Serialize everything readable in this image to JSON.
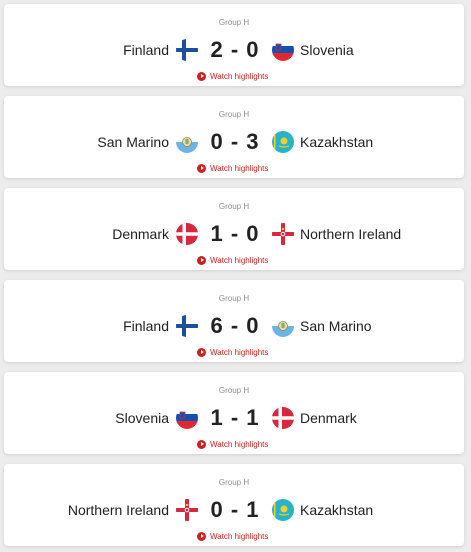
{
  "colors": {
    "background": "#ececec",
    "card": "#ffffff",
    "accent_red": "#d01e1e",
    "text": "#222222",
    "muted": "#8f8f8f"
  },
  "matches": [
    {
      "group": "Group H",
      "home": "Finland",
      "home_flag": "finland-flag",
      "score": "2 - 0",
      "away": "Slovenia",
      "away_flag": "slovenia-flag",
      "watch_label": "Watch highlights"
    },
    {
      "group": "Group H",
      "home": "San Marino",
      "home_flag": "san-marino-flag",
      "score": "0 - 3",
      "away": "Kazakhstan",
      "away_flag": "kazakhstan-flag",
      "watch_label": "Watch highlights"
    },
    {
      "group": "Group H",
      "home": "Denmark",
      "home_flag": "denmark-flag",
      "score": "1 - 0",
      "away": "Northern Ireland",
      "away_flag": "northern-ireland-flag",
      "watch_label": "Watch highlights"
    },
    {
      "group": "Group H",
      "home": "Finland",
      "home_flag": "finland-flag",
      "score": "6 - 0",
      "away": "San Marino",
      "away_flag": "san-marino-flag",
      "watch_label": "Watch highlights"
    },
    {
      "group": "Group H",
      "home": "Slovenia",
      "home_flag": "slovenia-flag",
      "score": "1 - 1",
      "away": "Denmark",
      "away_flag": "denmark-flag",
      "watch_label": "Watch highlights"
    },
    {
      "group": "Group H",
      "home": "Northern Ireland",
      "home_flag": "northern-ireland-flag",
      "score": "0 - 1",
      "away": "Kazakhstan",
      "away_flag": "kazakhstan-flag",
      "watch_label": "Watch highlights"
    }
  ]
}
